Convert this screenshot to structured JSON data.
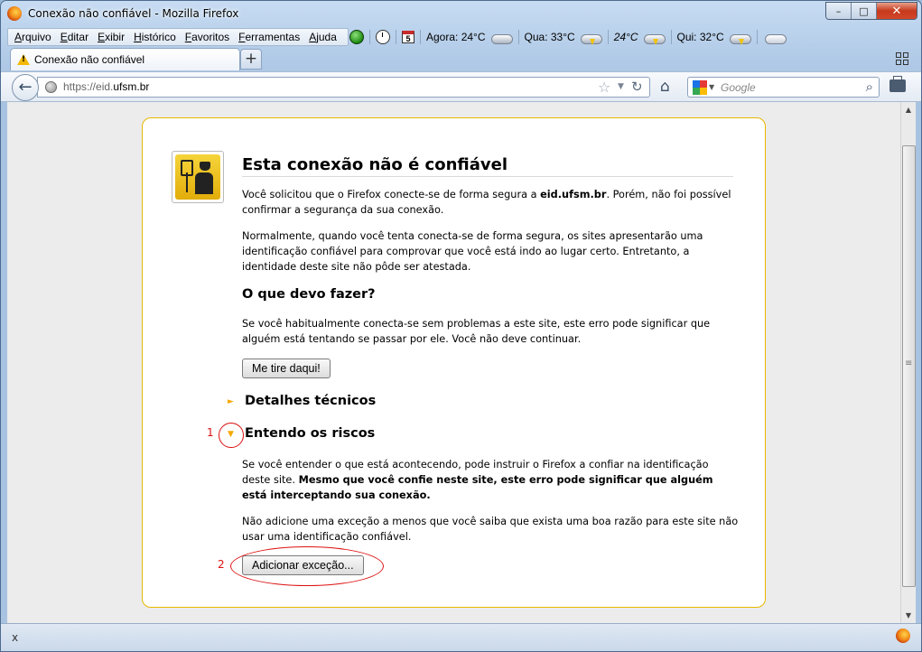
{
  "window": {
    "title": "Conexão não confiável - Mozilla Firefox",
    "controls": {
      "minimize": "–",
      "maximize": "□",
      "close": "✕"
    }
  },
  "menu": {
    "items": [
      {
        "label": "Arquivo",
        "accel": "A",
        "rest": "rquivo"
      },
      {
        "label": "Editar",
        "accel": "E",
        "rest": "ditar"
      },
      {
        "label": "Exibir",
        "accel": "E",
        "rest": "xibir"
      },
      {
        "label": "Histórico",
        "accel": "H",
        "rest": "istórico"
      },
      {
        "label": "Favoritos",
        "accel": "F",
        "rest": "avoritos"
      },
      {
        "label": "Ferramentas",
        "accel": "F",
        "rest": "erramentas"
      },
      {
        "label": "Ajuda",
        "accel": "A",
        "rest": "juda"
      }
    ]
  },
  "weather": {
    "calendar_day": "5",
    "now": "Agora: 24°C",
    "wed": "Qua: 33°C",
    "wed_low": "24°C",
    "thu": "Qui: 32°C"
  },
  "tab": {
    "label": "Conexão não confiável",
    "new_tab": "+"
  },
  "nav": {
    "back": "←",
    "url_scheme": "https://eid.",
    "url_domain": "ufsm.br",
    "star": "☆",
    "dropdown": "▼",
    "reload": "↻",
    "home": "⌂",
    "search_placeholder": "Google",
    "search_icon": "⌕"
  },
  "page": {
    "title": "Esta conexão não é confiável",
    "p1_a": "Você solicitou que o Firefox conecte-se de forma segura a ",
    "p1_host": "eid.ufsm.br",
    "p1_b": ". Porém, não foi possível confirmar a segurança da sua conexão.",
    "p2": "Normalmente, quando você tenta conecta-se de forma segura, os sites apresentarão uma identificação confiável para comprovar que você está indo ao lugar certo. Entretanto, a identidade deste site não pôde ser atestada.",
    "what_heading": "O que devo fazer?",
    "p3": "Se você habitualmente conecta-se sem problemas a este site, este erro pode significar que alguém está tentando se passar por ele. Você não deve continuar.",
    "get_out_button": "Me tire daqui!",
    "tech_details": "Detalhes técnicos",
    "risks": "Entendo os riscos",
    "p4": "Se você entender o que está acontecendo, pode instruir o Firefox a confiar na identificação deste site.",
    "p4_bold": "Mesmo que você confie neste site, este erro pode significar que alguém está interceptando sua conexão.",
    "p5": "Não adicione uma exceção a menos que você saiba que exista uma boa razão para este site não usar uma identificação confiável.",
    "add_exception_button": "Adicionar exceção...",
    "collapsed_marker": "►",
    "expanded_marker": "▼"
  },
  "annotations": {
    "one": "1",
    "two": "2"
  },
  "statusbar": {
    "close": "x"
  },
  "colors": {
    "panel_border": "#e8b800",
    "annotation": "#dd1111",
    "triangle": "#f5a800"
  }
}
